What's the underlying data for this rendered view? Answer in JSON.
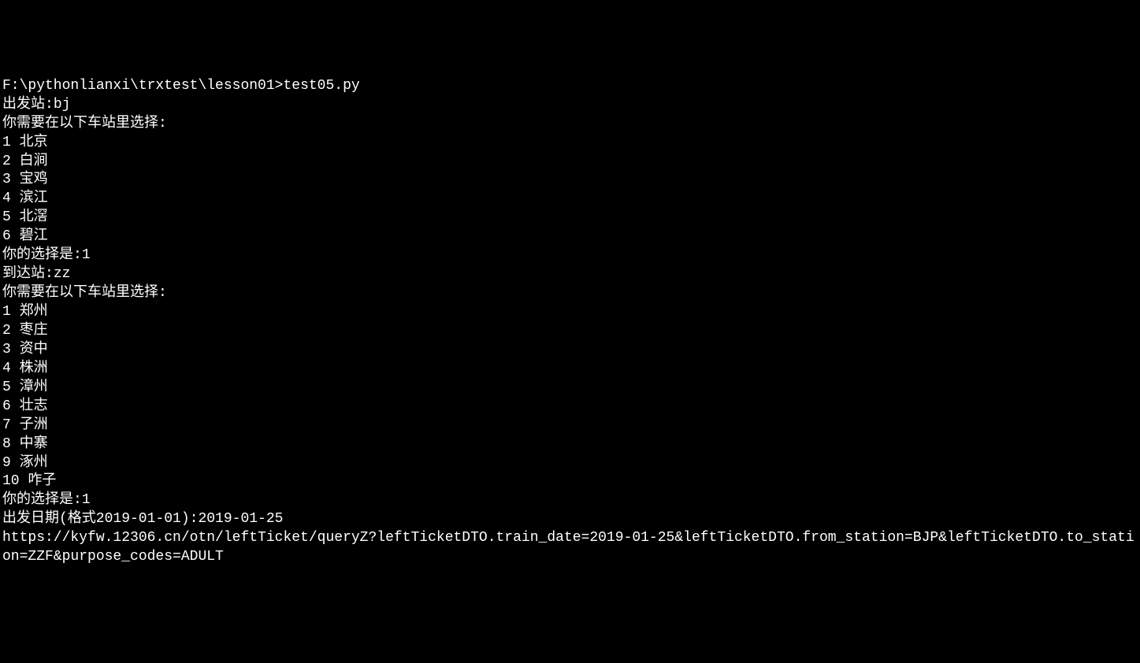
{
  "prompt_path": "F:\\pythonlianxi\\trxtest\\lesson01>",
  "command": "test05.py",
  "departure_label": "出发站:",
  "departure_input": "bj",
  "select_station_prompt": "你需要在以下车站里选择:",
  "departure_options": [
    "1 北京",
    "2 白涧",
    "3 宝鸡",
    "4 滨江",
    "5 北滘",
    "6 碧江"
  ],
  "your_choice_label": "你的选择是:",
  "departure_choice": "1",
  "arrival_label": "到达站:",
  "arrival_input": "zz",
  "arrival_options": [
    "1 郑州",
    "2 枣庄",
    "3 资中",
    "4 株洲",
    "5 漳州",
    "6 壮志",
    "7 子洲",
    "8 中寨",
    "9 涿州",
    "10 咋子"
  ],
  "arrival_choice": "1",
  "date_label": "出发日期(格式2019-01-01):",
  "date_input": "2019-01-25",
  "output_url": "https://kyfw.12306.cn/otn/leftTicket/queryZ?leftTicketDTO.train_date=2019-01-25&leftTicketDTO.from_station=BJP&leftTicketDTO.to_station=ZZF&purpose_codes=ADULT"
}
